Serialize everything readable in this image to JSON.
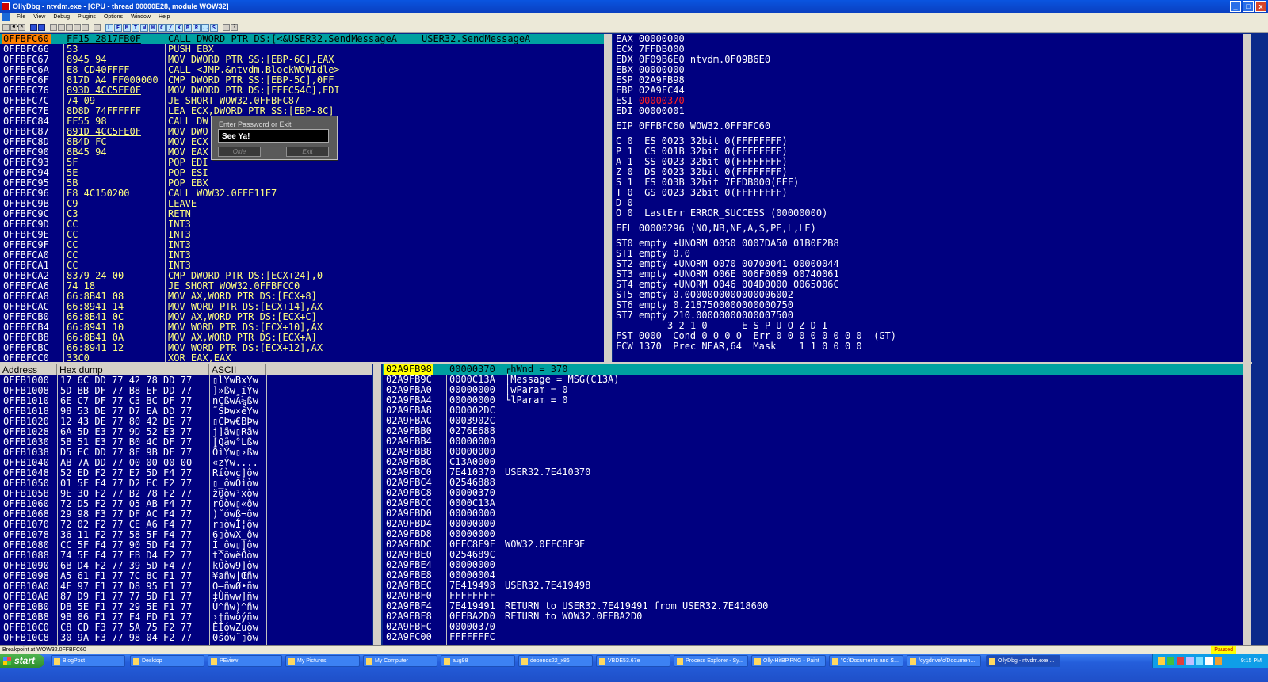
{
  "window": {
    "title": "OllyDbg - ntvdm.exe - [CPU - thread 00000E28, module WOW32]",
    "min": "_",
    "max": "□",
    "close": "x"
  },
  "menu": [
    "File",
    "View",
    "Debug",
    "Plugins",
    "Options",
    "Window",
    "Help"
  ],
  "toolbar": {
    "buttons": [
      "◄◄",
      "✕",
      "▶",
      "❚❚",
      "↘",
      "↓",
      "→",
      "↑",
      "→|"
    ],
    "letters": [
      "L",
      "E",
      "M",
      "T",
      "W",
      "H",
      "C",
      "/",
      "K",
      "B",
      "R",
      "...",
      "S",
      "",
      "?"
    ]
  },
  "cpu": {
    "rows": [
      {
        "addr": "0FFBFC60",
        "hex": "FF15 2817FB0F",
        "asm": "CALL DWORD PTR DS:[<&USER32.SendMessageA",
        "cmt": "USER32.SendMessageA",
        "sel": true
      },
      {
        "addr": "0FFBFC66",
        "hex": "53",
        "asm": "PUSH EBX",
        "cmt": ""
      },
      {
        "addr": "0FFBFC67",
        "hex": "8945 94",
        "asm": "MOV DWORD PTR SS:[EBP-6C],EAX",
        "cmt": ""
      },
      {
        "addr": "0FFBFC6A",
        "hex": "E8 CD40FFFF",
        "asm": "CALL <JMP.&ntvdm.BlockWOWIdle>",
        "cmt": ""
      },
      {
        "addr": "0FFBFC6F",
        "hex": "817D A4 FF000000",
        "asm": "CMP DWORD PTR SS:[EBP-5C],0FF",
        "cmt": ""
      },
      {
        "addr": "0FFBFC76",
        "hex": "893D 4CC5FE0F",
        "asm": "MOV DWORD PTR DS:[FFEC54C],EDI",
        "cmt": ""
      },
      {
        "addr": "0FFBFC7C",
        "hex": "74 09",
        "asm": "JE SHORT WOW32.0FFBFC87",
        "cmt": ""
      },
      {
        "addr": "0FFBFC7E",
        "hex": "8D8D 74FFFFFF",
        "asm": "LEA ECX,DWORD PTR SS:[EBP-8C]",
        "cmt": ""
      },
      {
        "addr": "0FFBFC84",
        "hex": "FF55 98",
        "asm": "CALL DW",
        "cmt": ""
      },
      {
        "addr": "0FFBFC87",
        "hex": "891D 4CC5FE0F",
        "asm": "MOV DWO                  EBX",
        "cmt": ""
      },
      {
        "addr": "0FFBFC8D",
        "hex": "8B4D FC",
        "asm": "MOV ECX                  ]",
        "cmt": ""
      },
      {
        "addr": "0FFBFC90",
        "hex": "8B45 94",
        "asm": "MOV EAX                  C]",
        "cmt": ""
      },
      {
        "addr": "0FFBFC93",
        "hex": "5F",
        "asm": "POP EDI",
        "cmt": ""
      },
      {
        "addr": "0FFBFC94",
        "hex": "5E",
        "asm": "POP ESI",
        "cmt": ""
      },
      {
        "addr": "0FFBFC95",
        "hex": "5B",
        "asm": "POP EBX",
        "cmt": ""
      },
      {
        "addr": "0FFBFC96",
        "hex": "E8 4C150200",
        "asm": "CALL WOW32.0FFE11E7",
        "cmt": ""
      },
      {
        "addr": "0FFBFC9B",
        "hex": "C9",
        "asm": "LEAVE",
        "cmt": ""
      },
      {
        "addr": "0FFBFC9C",
        "hex": "C3",
        "asm": "RETN",
        "cmt": ""
      },
      {
        "addr": "0FFBFC9D",
        "hex": "CC",
        "asm": "INT3",
        "cmt": ""
      },
      {
        "addr": "0FFBFC9E",
        "hex": "CC",
        "asm": "INT3",
        "cmt": ""
      },
      {
        "addr": "0FFBFC9F",
        "hex": "CC",
        "asm": "INT3",
        "cmt": ""
      },
      {
        "addr": "0FFBFCA0",
        "hex": "CC",
        "asm": "INT3",
        "cmt": ""
      },
      {
        "addr": "0FFBFCA1",
        "hex": "CC",
        "asm": "INT3",
        "cmt": ""
      },
      {
        "addr": "0FFBFCA2",
        "hex": "8379 24 00",
        "asm": "CMP DWORD PTR DS:[ECX+24],0",
        "cmt": ""
      },
      {
        "addr": "0FFBFCA6",
        "hex": "74 18",
        "asm": "JE SHORT WOW32.0FFBFCC0",
        "cmt": ""
      },
      {
        "addr": "0FFBFCA8",
        "hex": "66:8B41 08",
        "asm": "MOV AX,WORD PTR DS:[ECX+8]",
        "cmt": ""
      },
      {
        "addr": "0FFBFCAC",
        "hex": "66:8941 14",
        "asm": "MOV WORD PTR DS:[ECX+14],AX",
        "cmt": ""
      },
      {
        "addr": "0FFBFCB0",
        "hex": "66:8B41 0C",
        "asm": "MOV AX,WORD PTR DS:[ECX+C]",
        "cmt": ""
      },
      {
        "addr": "0FFBFCB4",
        "hex": "66:8941 10",
        "asm": "MOV WORD PTR DS:[ECX+10],AX",
        "cmt": ""
      },
      {
        "addr": "0FFBFCB8",
        "hex": "66:8B41 0A",
        "asm": "MOV AX,WORD PTR DS:[ECX+A]",
        "cmt": ""
      },
      {
        "addr": "0FFBFCBC",
        "hex": "66:8941 12",
        "asm": "MOV WORD PTR DS:[ECX+12],AX",
        "cmt": ""
      },
      {
        "addr": "0FFBFCC0",
        "hex": "33C0",
        "asm": "XOR EAX,EAX",
        "cmt": ""
      }
    ]
  },
  "registers": {
    "r1": "EAX 00000000",
    "r2": "ECX 7FFDB000",
    "r3": "EDX 0F09B6E0 ntvdm.0F09B6E0",
    "r4": "EBX 00000000",
    "r5": "ESP 02A9FB98",
    "r6": "EBP 02A9FC44",
    "r7a": "ESI ",
    "r7b": "00000370",
    "r8": "EDI 00000001",
    "eip": "EIP 0FFBFC60 WOW32.0FFBFC60",
    "f1": "C 0  ES 0023 32bit 0(FFFFFFFF)",
    "f2": "P 1  CS 001B 32bit 0(FFFFFFFF)",
    "f3": "A 1  SS 0023 32bit 0(FFFFFFFF)",
    "f4": "Z 0  DS 0023 32bit 0(FFFFFFFF)",
    "f5": "S 1  FS 003B 32bit 7FFDB000(FFF)",
    "f6": "T 0  GS 0023 32bit 0(FFFFFFFF)",
    "f7": "D 0",
    "f8": "O 0  LastErr ERROR_SUCCESS (00000000)",
    "efl": "EFL 00000296 (NO,NB,NE,A,S,PE,L,LE)",
    "st0": "ST0 empty +UNORM 0050 0007DA50 01B0F2B8",
    "st1": "ST1 empty 0.0",
    "st2": "ST2 empty +UNORM 0070 00700041 00000044",
    "st3": "ST3 empty +UNORM 006E 006F0069 00740061",
    "st4": "ST4 empty +UNORM 0046 004D0000 0065006C",
    "st5": "ST5 empty 0.0000000000000006002",
    "st6": "ST6 empty 0.2187500000000000750",
    "st7": "ST7 empty 210.00000000000007500",
    "fhdr": "         3 2 1 0      E S P U O Z D I",
    "fst": "FST 0000  Cond 0 0 0 0  Err 0 0 0 0 0 0 0 0  (GT)",
    "fcw": "FCW 1370  Prec NEAR,64  Mask    1 1 0 0 0 0"
  },
  "dump": {
    "headers": {
      "address": "Address",
      "hex": "Hex dump",
      "ascii": "ASCII"
    },
    "rows": [
      {
        "a": "0FFB1000",
        "h": "17 6C DD 77 42 78 DD 77",
        "c": "▯lÝwBxÝw"
      },
      {
        "a": "0FFB1008",
        "h": "5D BB DF 77 B8 EF DD 77",
        "c": "]»ßw¸ïÝw"
      },
      {
        "a": "0FFB1010",
        "h": "6E C7 DF 77 C3 BC DF 77",
        "c": "nÇßwÃ¼ßw"
      },
      {
        "a": "0FFB1018",
        "h": "98 53 DE 77 D7 EA DD 77",
        "c": "˜SÞw×êÝw"
      },
      {
        "a": "0FFB1020",
        "h": "12 43 DE 77 80 42 DE 77",
        "c": "▯CÞw€BÞw"
      },
      {
        "a": "0FFB1028",
        "h": "6A 5D E3 77 9D 52 E3 77",
        "c": "j]ãw▯Rãw"
      },
      {
        "a": "0FFB1030",
        "h": "5B 51 E3 77 B0 4C DF 77",
        "c": "[Qãw°Lßw"
      },
      {
        "a": "0FFB1038",
        "h": "D5 EC DD 77 8F 9B DF 77",
        "c": "ÕìÝw▯›ßw"
      },
      {
        "a": "0FFB1040",
        "h": "AB 7A DD 77 00 00 00 00",
        "c": "«zÝw...."
      },
      {
        "a": "0FFB1048",
        "h": "52 ED F2 77 E7 5D F4 77",
        "c": "Ríòwç]ôw"
      },
      {
        "a": "0FFB1050",
        "h": "01 5F F4 77 D2 EC F2 77",
        "c": "▯_ôwÒìòw"
      },
      {
        "a": "0FFB1058",
        "h": "9E 30 F2 77 B2 78 F2 77",
        "c": "ž0òw²xòw"
      },
      {
        "a": "0FFB1060",
        "h": "72 D5 F2 77 05 AB F4 77",
        "c": "rÕòw▯«ôw"
      },
      {
        "a": "0FFB1068",
        "h": "29 98 F3 77 DF AC F4 77",
        "c": ")˜ówß¬ôw"
      },
      {
        "a": "0FFB1070",
        "h": "72 02 F2 77 CE A6 F4 77",
        "c": "r▯òwÎ¦ôw"
      },
      {
        "a": "0FFB1078",
        "h": "36 11 F2 77 58 5F F4 77",
        "c": "6▯òwX_ôw"
      },
      {
        "a": "0FFB1080",
        "h": "CC 5F F4 77 90 5D F4 77",
        "c": "Ì_ôw▯]ôw"
      },
      {
        "a": "0FFB1088",
        "h": "74 5E F4 77 EB D4 F2 77",
        "c": "t^ôwëÔòw"
      },
      {
        "a": "0FFB1090",
        "h": "6B D4 F2 77 39 5D F4 77",
        "c": "kÔòw9]ôw"
      },
      {
        "a": "0FFB1098",
        "h": "A5 61 F1 77 7C 8C F1 77",
        "c": "¥añw|Œñw"
      },
      {
        "a": "0FFB10A0",
        "h": "4F 97 F1 77 D8 95 F1 77",
        "c": "O—ñwØ•ñw"
      },
      {
        "a": "0FFB10A8",
        "h": "87 D9 F1 77 77 5D F1 77",
        "c": "‡Ùñww]ñw"
      },
      {
        "a": "0FFB10B0",
        "h": "DB 5E F1 77 29 5E F1 77",
        "c": "Û^ñw)^ñw"
      },
      {
        "a": "0FFB10B8",
        "h": "9B 86 F1 77 F4 FD F1 77",
        "c": "›†ñwôýñw"
      },
      {
        "a": "0FFB10C0",
        "h": "C8 CD F3 77 5A 75 F2 77",
        "c": "ÈÍówZuòw"
      },
      {
        "a": "0FFB10C8",
        "h": "30 9A F3 77 98 04 F2 77",
        "c": "0šów˜▯òw"
      }
    ]
  },
  "stack": {
    "rows": [
      {
        "a": "02A9FB98",
        "v": "00000370",
        "c": "┌hWnd = 370",
        "sel": true
      },
      {
        "a": "02A9FB9C",
        "v": "0000C13A",
        "c": "│Message = MSG(C13A)"
      },
      {
        "a": "02A9FBA0",
        "v": "00000000",
        "c": "│wParam = 0"
      },
      {
        "a": "02A9FBA4",
        "v": "00000000",
        "c": "└lParam = 0"
      },
      {
        "a": "02A9FBA8",
        "v": "000002DC",
        "c": ""
      },
      {
        "a": "02A9FBAC",
        "v": "0003902C",
        "c": ""
      },
      {
        "a": "02A9FBB0",
        "v": "0276E688",
        "c": ""
      },
      {
        "a": "02A9FBB4",
        "v": "00000000",
        "c": ""
      },
      {
        "a": "02A9FBB8",
        "v": "00000000",
        "c": ""
      },
      {
        "a": "02A9FBBC",
        "v": "C13A0000",
        "c": ""
      },
      {
        "a": "02A9FBC0",
        "v": "7E410370",
        "c": "USER32.7E410370"
      },
      {
        "a": "02A9FBC4",
        "v": "02546888",
        "c": ""
      },
      {
        "a": "02A9FBC8",
        "v": "00000370",
        "c": ""
      },
      {
        "a": "02A9FBCC",
        "v": "0000C13A",
        "c": ""
      },
      {
        "a": "02A9FBD0",
        "v": "00000000",
        "c": ""
      },
      {
        "a": "02A9FBD4",
        "v": "00000000",
        "c": ""
      },
      {
        "a": "02A9FBD8",
        "v": "00000000",
        "c": ""
      },
      {
        "a": "02A9FBDC",
        "v": "0FFC8F9F",
        "c": "WOW32.0FFC8F9F"
      },
      {
        "a": "02A9FBE0",
        "v": "0254689C",
        "c": ""
      },
      {
        "a": "02A9FBE4",
        "v": "00000000",
        "c": ""
      },
      {
        "a": "02A9FBE8",
        "v": "00000004",
        "c": ""
      },
      {
        "a": "02A9FBEC",
        "v": "7E419498",
        "c": "USER32.7E419498"
      },
      {
        "a": "02A9FBF0",
        "v": "FFFFFFFF",
        "c": ""
      },
      {
        "a": "02A9FBF4",
        "v": "7E419491",
        "c": "RETURN to USER32.7E419491 from USER32.7E418600"
      },
      {
        "a": "02A9FBF8",
        "v": "0FFBA2D0",
        "c": "RETURN to WOW32.0FFBA2D0"
      },
      {
        "a": "02A9FBFC",
        "v": "00000370",
        "c": ""
      },
      {
        "a": "02A9FC00",
        "v": "FFFFFFFC",
        "c": ""
      }
    ]
  },
  "dialog": {
    "title": "Enter Password or Exit",
    "value": "See Ya!",
    "ok": "Okie",
    "exit": "Exit"
  },
  "status": {
    "text": "Breakpoint at WOW32.0FFBFC60",
    "paused": "Paused"
  },
  "taskbar": {
    "start": "start",
    "tasks": [
      "BlogPost",
      "Desktop",
      "PEview",
      "My Pictures",
      "My Computer",
      "aug98",
      "depends22_x86",
      "VBDE53.67e",
      "Process Explorer - Sy...",
      "Olly-HitBP.PNG - Paint",
      "\"C:\\Documents and S...",
      "/cygdrive/c/Documen...",
      "OllyDbg - ntvdm.exe ..."
    ],
    "clock": "9:15 PM"
  }
}
